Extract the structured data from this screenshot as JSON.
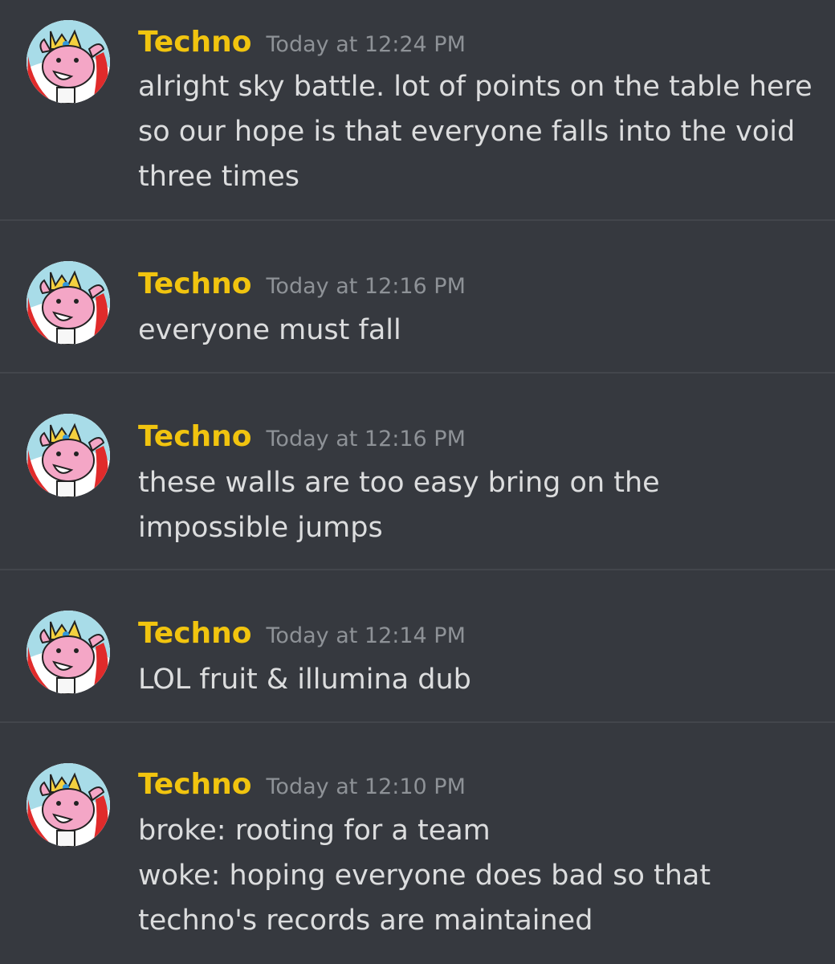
{
  "messages": [
    {
      "author": "Techno",
      "timestamp": "Today at 12:24 PM",
      "lines": [
        "alright sky battle. lot of points on the table here",
        "so our hope is that everyone falls into the void",
        "three times"
      ]
    },
    {
      "author": "Techno",
      "timestamp": "Today at 12:16 PM",
      "lines": [
        "everyone must fall"
      ]
    },
    {
      "author": "Techno",
      "timestamp": "Today at 12:16 PM",
      "lines": [
        "these walls are too easy bring on the",
        "impossible jumps"
      ]
    },
    {
      "author": "Techno",
      "timestamp": "Today at 12:14 PM",
      "lines": [
        "LOL fruit & illumina dub"
      ]
    },
    {
      "author": "Techno",
      "timestamp": "Today at 12:10 PM",
      "lines": [
        "broke: rooting for a team",
        "woke: hoping everyone does bad so that",
        "techno's records are maintained"
      ]
    }
  ],
  "colors": {
    "background": "#36393f",
    "username": "#f1c40f",
    "timestamp": "#8e9297",
    "message_text": "#dcddde",
    "divider": "#43464c"
  },
  "icons": {
    "avatar": "pig-with-crown-avatar"
  }
}
